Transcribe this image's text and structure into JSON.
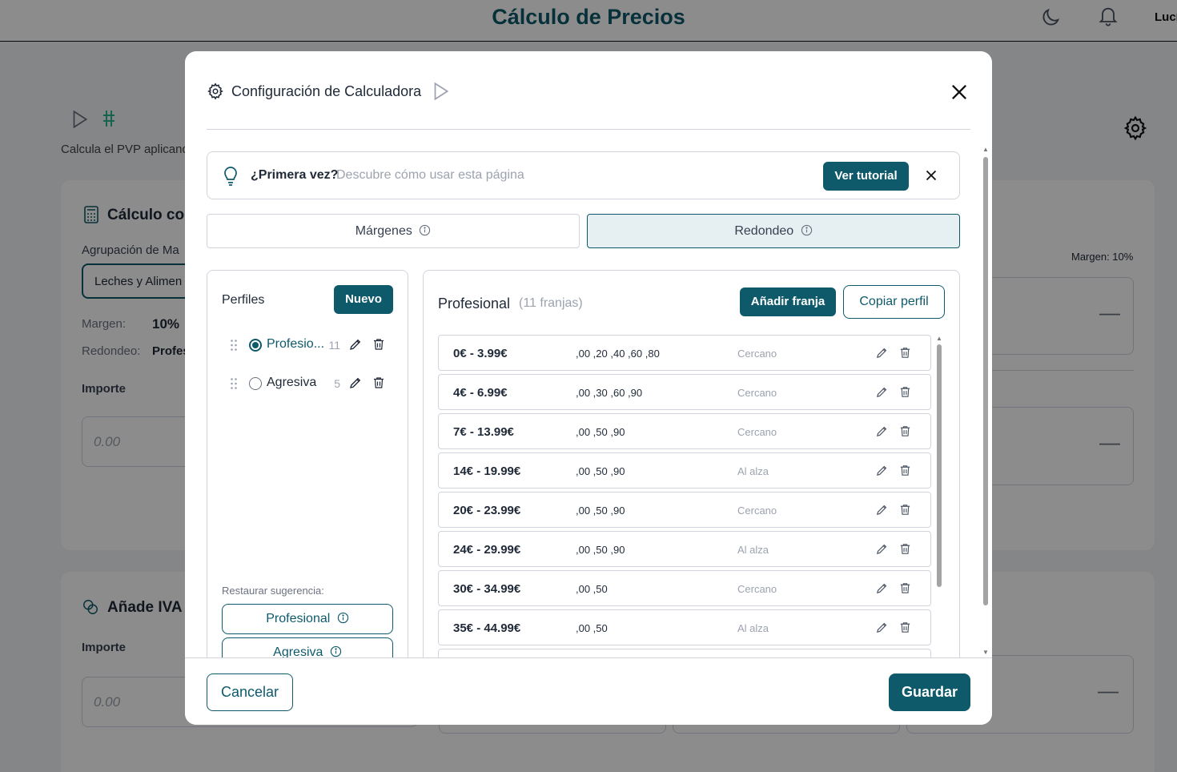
{
  "app": {
    "title": "Cálculo de Precios",
    "user_name": "Lucí"
  },
  "background": {
    "subtitle": "Calcula el PVP aplicand",
    "card1_title": "Cálculo con",
    "group_label": "Agrupación de Ma",
    "group_value": "Leches y Alimen",
    "margin_label": "Margen:",
    "margin_value": "10%",
    "rounding_label": "Redondeo:",
    "rounding_value": "Profes",
    "amount_label": "Importe",
    "amount_placeholder": "0.00",
    "margin_badge": "Margen: 10%",
    "card2_title": "Añade IVA",
    "card2_amount_label": "Importe",
    "card2_amount_placeholder": "0.00",
    "dash": "—"
  },
  "modal": {
    "title": "Configuración de Calculadora",
    "tip": {
      "question": "¿Primera vez?",
      "description": "Descubre cómo usar esta página",
      "button": "Ver tutorial"
    },
    "tabs": [
      {
        "label": "Márgenes",
        "active": false
      },
      {
        "label": "Redondeo",
        "active": true
      }
    ],
    "profiles": {
      "heading": "Perfiles",
      "new_button": "Nuevo",
      "items": [
        {
          "name": "Profesional",
          "display": "Profesio...",
          "count": "11",
          "selected": true
        },
        {
          "name": "Agresiva",
          "display": "Agresiva",
          "count": "5",
          "selected": false
        }
      ],
      "restore_label": "Restaurar sugerencia:",
      "restore_buttons": [
        "Profesional",
        "Agresiva"
      ]
    },
    "tiers_panel": {
      "title": "Profesional",
      "subtitle": "(11 franjas)",
      "add_button": "Añadir franja",
      "copy_button": "Copiar perfil",
      "tiers": [
        {
          "range": "0€ - 3.99€",
          "endings": ",00 ,20 ,40 ,60 ,80",
          "mode": "Cercano"
        },
        {
          "range": "4€ - 6.99€",
          "endings": ",00 ,30 ,60 ,90",
          "mode": "Cercano"
        },
        {
          "range": "7€ - 13.99€",
          "endings": ",00 ,50 ,90",
          "mode": "Cercano"
        },
        {
          "range": "14€ - 19.99€",
          "endings": ",00 ,50 ,90",
          "mode": "Al alza"
        },
        {
          "range": "20€ - 23.99€",
          "endings": ",00 ,50 ,90",
          "mode": "Cercano"
        },
        {
          "range": "24€ - 29.99€",
          "endings": ",00 ,50 ,90",
          "mode": "Al alza"
        },
        {
          "range": "30€ - 34.99€",
          "endings": ",00 ,50",
          "mode": "Cercano"
        },
        {
          "range": "35€ - 44.99€",
          "endings": ",00 ,50",
          "mode": "Al alza"
        }
      ]
    },
    "footer": {
      "cancel": "Cancelar",
      "save": "Guardar"
    }
  },
  "colors": {
    "brand": "#0e5a6b",
    "accent_green": "#2bb58c"
  }
}
